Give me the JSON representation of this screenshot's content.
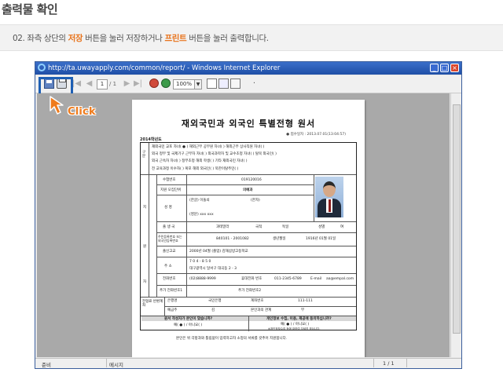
{
  "page": {
    "heading": "출력물 확인",
    "instruction": {
      "prefix": "02. 좌측 상단의 ",
      "save_word": "저장",
      "middle": " 버튼을 눌러 저장하거나 ",
      "print_word": "프린트",
      "suffix": " 버튼을 눌러 출력합니다."
    },
    "click_label": "Click"
  },
  "window": {
    "title": "http://ta.uwayapply.com/common/report/ - Windows Internet Explorer",
    "buttons": [
      "_",
      "□",
      "×"
    ]
  },
  "toolbar": {
    "page_current": "1",
    "page_total": "/ 1",
    "zoom": "100%"
  },
  "status": {
    "left": "준비",
    "mid": "메시지",
    "page": "1 / 1"
  },
  "document": {
    "title": "재외국민과 외국인 특별전형 원서",
    "submitted": "● 접수일자 : 2013.07.01(13:04:57)",
    "year": "2014학년도",
    "section_gubun": "구 분",
    "options": [
      "재외국민 교포 자녀( ● ) 해외근무 공무원 자녀(   ) 해외근무 상사직원 자녀(   )",
      "외국 정부 및 국제기구 근무자 자녀(   ) 외국과학자 및 교수초청 자녀(   ) 탈북 외국인(   )",
      "외국 근속자 자녀(   ) 정부초청 해외 학생(   ) 기타 재외국민 자녀(   )",
      "전 교육과정 이수자(   ) 복포 해외 외국인(   ) 북한이탈주민(   )"
    ],
    "side_ji": "지",
    "side_won": "원",
    "side_ja": "자",
    "labels": {
      "exam_no": "수험번호",
      "major": "지원 모집단위",
      "name": "성   명",
      "birth_place": "출 생 국",
      "resident_no": "주민등록번호 또는 외국인등록번호",
      "school_date": "출신고교",
      "address": "주   소",
      "phone": "전화번호",
      "extra_phone1": "추가 전화번호1",
      "extra_phone2": "추가 전화번호2",
      "refund_account": "전형료 반환계좌",
      "bank": "은행명",
      "account_no": "계좌번호",
      "holder": "예금주",
      "relation": "본인과의 관계",
      "nation": "국적",
      "gender": "성별",
      "birthdate": "생년월일",
      "mobile": "휴대전화 번호",
      "email": "E-mail"
    },
    "values": {
      "exam_no": "019120016",
      "major": "의예과",
      "name_kor": "(한글)  이돌쇠",
      "name_hanja": "(한자)",
      "name_eng": "(영문)  xxx xxx",
      "birth_country": "과테말라",
      "nationality": "독일",
      "gender": "여",
      "resident_no": "840101 - 2001082",
      "birthdate": "1916년 01월 01일",
      "school": "2000년 04월 (졸업)  김해삼방고등학교",
      "zip": "7 0 4  -  8 5 0",
      "address": "대구광역시 달서구 대곡동 2 - 3",
      "phone": "(02)8888-9999",
      "mobile": "011-2345-6789",
      "email": "aa@empal.com",
      "bank": "국민은행",
      "account": "111-111",
      "holder": "김",
      "relation": "부"
    },
    "consent1": "원서 작성자가 본인이 맞습니까?",
    "consent1_ans": "예( ● ) / 아니요(   )",
    "consent2": "개인정보 수집, 이용, 제공에 동의하십니까?",
    "consent2_ans": "예( ● ) / 아니요(   )",
    "consent2_note": "※개인정보수집 등에 대하여 자세히 보십니다.",
    "footer_note": "본인은 위 각항과와 틀림없이 입력하고자 소정의 서류를 갖추어 지원합니다."
  }
}
